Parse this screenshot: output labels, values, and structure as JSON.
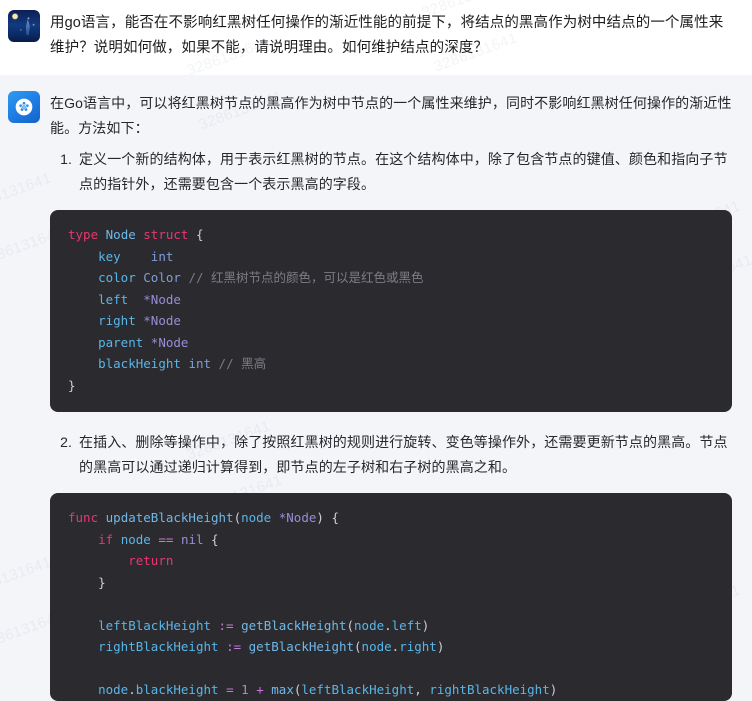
{
  "watermark": {
    "text": "3286131641",
    "color": "#8892a6"
  },
  "colors": {
    "user_bg": "#ffffff",
    "assistant_bg": "#f4f5f9",
    "code_bg": "#2b2b2f",
    "accent": "#1f7fe6"
  },
  "conversation": {
    "user": {
      "avatar_name": "user-avatar",
      "message": "用go语言，能否在不影响红黑树任何操作的渐近性能的前提下，将结点的黑高作为树中结点的一个属性来维护？说明如何做，如果不能，请说明理由。如何维护结点的深度？"
    },
    "assistant": {
      "avatar_name": "assistant-avatar",
      "intro": "在Go语言中，可以将红黑树节点的黑高作为树中节点的一个属性来维护，同时不影响红黑树任何操作的渐近性能。方法如下：",
      "steps": [
        "定义一个新的结构体，用于表示红黑树的节点。在这个结构体中，除了包含节点的键值、颜色和指向子节点的指针外，还需要包含一个表示黑高的字段。",
        "在插入、删除等操作中，除了按照红黑树的规则进行旋转、变色等操作外，还需要更新节点的黑高。节点的黑高可以通过递归计算得到，即节点的左子树和右子树的黑高之和。"
      ],
      "code_blocks": [
        {
          "language": "go",
          "lines": [
            "type Node struct {",
            "    key    int",
            "    color Color // 红黑树节点的颜色，可以是红色或黑色",
            "    left  *Node",
            "    right *Node",
            "    parent *Node",
            "    blackHeight int // 黑高",
            "}"
          ]
        },
        {
          "language": "go",
          "lines": [
            "func updateBlackHeight(node *Node) {",
            "    if node == nil {",
            "        return",
            "    }",
            "",
            "    leftBlackHeight := getBlackHeight(node.left)",
            "    rightBlackHeight := getBlackHeight(node.right)",
            "",
            "    node.blackHeight = 1 + max(leftBlackHeight, rightBlackHeight)"
          ]
        }
      ]
    }
  }
}
